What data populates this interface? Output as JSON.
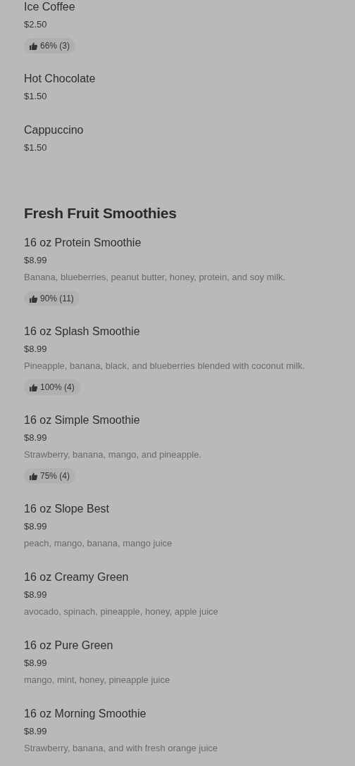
{
  "sections": [
    {
      "items": [
        {
          "name": "Ice Coffee",
          "price": "$2.50",
          "rating": "66% (3)"
        },
        {
          "name": "Hot Chocolate",
          "price": "$1.50"
        },
        {
          "name": "Cappuccino",
          "price": "$1.50"
        }
      ]
    },
    {
      "title": "Fresh Fruit Smoothies",
      "items": [
        {
          "name": "16 oz Protein Smoothie",
          "price": "$8.99",
          "description": "Banana, blueberries, peanut butter, honey, protein, and soy milk.",
          "rating": "90% (11)"
        },
        {
          "name": "16 oz Splash Smoothie",
          "price": "$8.99",
          "description": "Pineapple, banana, black, and blueberries blended with coconut milk.",
          "rating": "100% (4)"
        },
        {
          "name": "16 oz Simple Smoothie",
          "price": "$8.99",
          "description": "Strawberry, banana, mango, and pineapple.",
          "rating": "75% (4)"
        },
        {
          "name": "16 oz Slope Best",
          "price": "$8.99",
          "description": "peach, mango, banana, mango juice"
        },
        {
          "name": "16 oz Creamy Green",
          "price": "$8.99",
          "description": "avocado, spinach, pineapple, honey, apple juice"
        },
        {
          "name": "16 oz Pure Green",
          "price": "$8.99",
          "description": "mango, mint, honey, pineapple juice"
        },
        {
          "name": "16 oz Morning Smoothie",
          "price": "$8.99",
          "description": "Strawberry, banana, and with fresh orange juice"
        }
      ]
    }
  ]
}
